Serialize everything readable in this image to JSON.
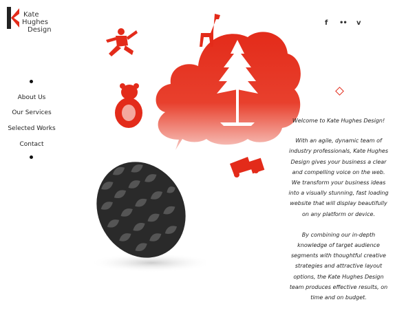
{
  "brand": {
    "logo_lines": [
      "Kate",
      "Hughes",
      "Design"
    ],
    "accent": "#e32b1a"
  },
  "social": [
    {
      "icon": "facebook-icon",
      "glyph": "f"
    },
    {
      "icon": "flickr-icon",
      "glyph": "••"
    },
    {
      "icon": "vimeo-icon",
      "glyph": "v"
    }
  ],
  "nav": {
    "items": [
      {
        "label": "About Us"
      },
      {
        "label": "Our Services"
      },
      {
        "label": "Selected Works"
      },
      {
        "label": "Contact"
      }
    ]
  },
  "content": {
    "welcome": "Welcome to Kate Hughes Design!",
    "paragraph1": "With an agile, dynamic team of industry professionals, Kate Hughes Design gives your business a clear and compelling voice on the web. We transform your business ideas into a visually stunning, fast loading website that will display beautifully on any platform or device.",
    "paragraph2": "By combining our in-depth knowledge of target audience segments with thoughtful creative strategies and attractive layout options, the Kate Hughes Design team produces effective results, on time and on budget."
  }
}
